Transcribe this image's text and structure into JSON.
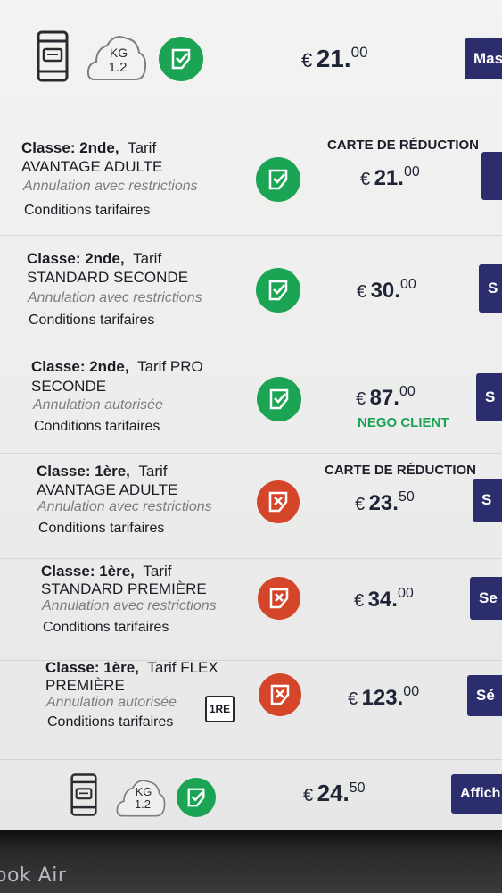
{
  "colors": {
    "accent": "#2b2d6d",
    "success": "#1aa454",
    "danger": "#d5452a",
    "text": "#1c1c24",
    "muted": "#7c7d82"
  },
  "summary_top": {
    "phone_icon": "smartphone-ticket-icon",
    "kg_label": "KG",
    "kg_value": "1.2",
    "status_icon": "check-ticket-icon",
    "currency": "€",
    "price_int": "21.",
    "price_dec": "00",
    "button_label": "Mas"
  },
  "fares": [
    {
      "class_label": "Classe: 2nde,",
      "tarif_prefix": "Tarif",
      "tarif_name": "AVANTAGE ADULTE",
      "cancellation": "Annulation avec restrictions",
      "conditions": "Conditions tarifaires",
      "status": "check-ticket-icon",
      "tag": "CARTE DE RÉDUCTION",
      "currency": "€",
      "price_int": "21.",
      "price_dec": "00",
      "button_label": ""
    },
    {
      "class_label": "Classe: 2nde,",
      "tarif_prefix": "Tarif",
      "tarif_name": "STANDARD SECONDE",
      "cancellation": "Annulation avec restrictions",
      "conditions": "Conditions tarifaires",
      "status": "check-ticket-icon",
      "tag": "",
      "currency": "€",
      "price_int": "30.",
      "price_dec": "00",
      "button_label": "S"
    },
    {
      "class_label": "Classe: 2nde,",
      "tarif_prefix": "Tarif PRO",
      "tarif_name": "SECONDE",
      "cancellation": "Annulation autorisée",
      "conditions": "Conditions tarifaires",
      "status": "check-ticket-icon",
      "tag": "NEGO CLIENT",
      "currency": "€",
      "price_int": "87.",
      "price_dec": "00",
      "button_label": "S"
    },
    {
      "class_label": "Classe: 1ère,",
      "tarif_prefix": "Tarif",
      "tarif_name": "AVANTAGE ADULTE",
      "cancellation": "Annulation avec restrictions",
      "conditions": "Conditions tarifaires",
      "status": "cross-ticket-icon",
      "tag": "CARTE DE RÉDUCTION",
      "currency": "€",
      "price_int": "23.",
      "price_dec": "50",
      "button_label": "S"
    },
    {
      "class_label": "Classe: 1ère,",
      "tarif_prefix": "Tarif",
      "tarif_name": "STANDARD PREMIÈRE",
      "cancellation": "Annulation avec restrictions",
      "conditions": "Conditions tarifaires",
      "status": "cross-ticket-icon",
      "tag": "",
      "currency": "€",
      "price_int": "34.",
      "price_dec": "00",
      "button_label": "Se"
    },
    {
      "class_label": "Classe: 1ère,",
      "tarif_prefix": "Tarif FLEX",
      "tarif_name": "PREMIÈRE",
      "cancellation": "Annulation autorisée",
      "conditions": "Conditions tarifaires",
      "status": "cross-ticket-icon",
      "tag": "",
      "class_badge": "1RE",
      "currency": "€",
      "price_int": "123.",
      "price_dec": "00",
      "button_label": "Sé"
    }
  ],
  "summary_bottom": {
    "phone_icon": "smartphone-ticket-icon",
    "kg_label": "KG",
    "kg_value": "1.2",
    "status_icon": "check-ticket-icon",
    "currency": "€",
    "price_int": "24.",
    "price_dec": "50",
    "button_label": "Affich"
  },
  "bezel": {
    "label": "ook Air"
  }
}
